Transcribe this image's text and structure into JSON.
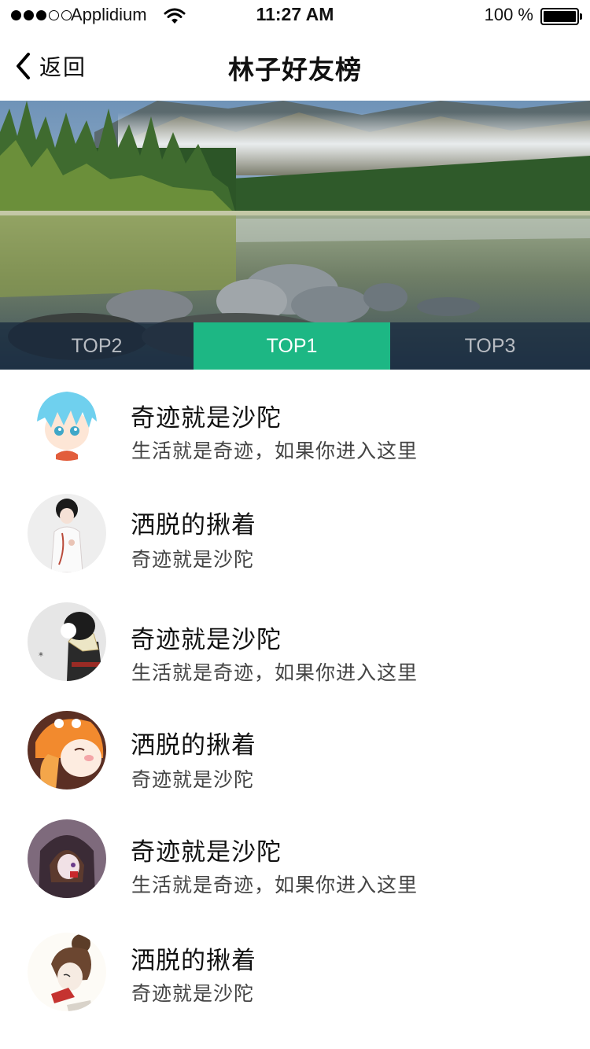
{
  "status_bar": {
    "carrier": "Applidium",
    "time": "11:27 AM",
    "battery": "100 %"
  },
  "nav": {
    "back_label": "返回",
    "title": "林子好友榜"
  },
  "hero": {
    "tabs": [
      {
        "label": "TOP2",
        "active": false
      },
      {
        "label": "TOP1",
        "active": true
      },
      {
        "label": "TOP3",
        "active": false
      }
    ],
    "accent_color": "#1db784"
  },
  "friends": [
    {
      "name": "奇迹就是沙陀",
      "subtitle": "生活就是奇迹，如果你进入这里",
      "avatar": "anime-boy-blue-hair-avatar"
    },
    {
      "name": "洒脱的揪着",
      "subtitle": "奇迹就是沙陀",
      "avatar": "boy-white-shirt-avatar"
    },
    {
      "name": "奇迹就是沙陀",
      "subtitle": "生活就是奇迹，如果你进入这里",
      "avatar": "boy-scarf-avatar"
    },
    {
      "name": "洒脱的揪着",
      "subtitle": "奇迹就是沙陀",
      "avatar": "girl-orange-hood-avatar"
    },
    {
      "name": "奇迹就是沙陀",
      "subtitle": "生活就是奇迹，如果你进入这里",
      "avatar": "girl-dark-hood-avatar"
    },
    {
      "name": "洒脱的揪着",
      "subtitle": "奇迹就是沙陀",
      "avatar": "girl-bun-hair-avatar"
    }
  ]
}
